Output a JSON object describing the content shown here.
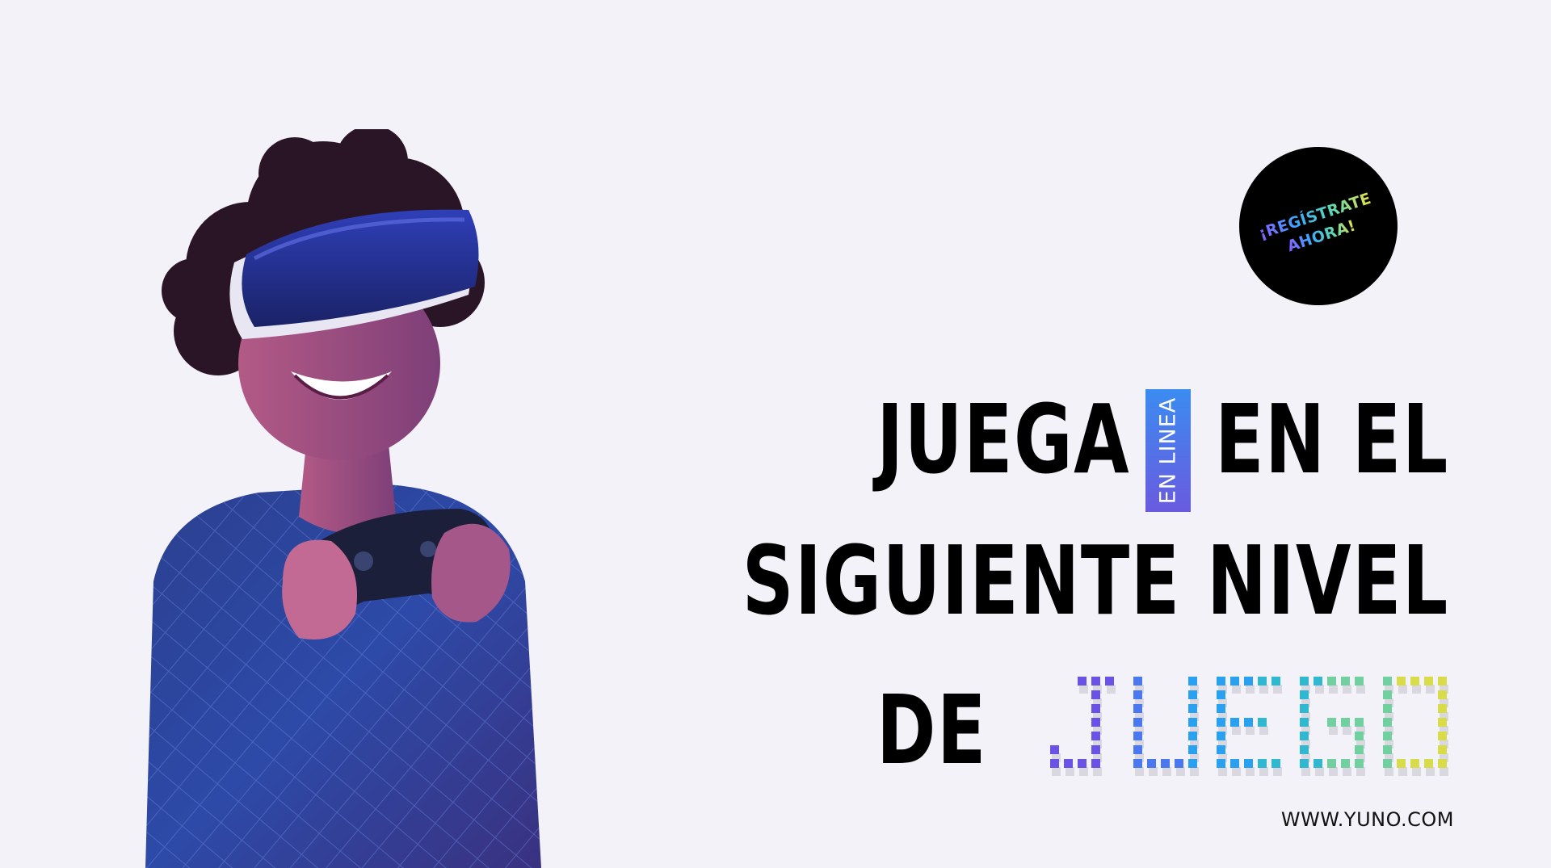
{
  "badge": {
    "line1": "¡REGÍSTRATE",
    "line2": "AHORA!"
  },
  "headline": {
    "line1_left": "JUEGA",
    "line1_right": "EN EL",
    "line2": "SIGUIENTE NIVEL",
    "line3": "DE"
  },
  "tag": {
    "label": "EN LINEA"
  },
  "pixel_word": {
    "text": "JUEGO",
    "colors": [
      "#6a52e6",
      "#4a78f0",
      "#2aa0f0",
      "#30b8d0",
      "#70d0a0",
      "#d8dc48"
    ]
  },
  "footer": {
    "url": "WWW.YUNO.COM"
  },
  "colors": {
    "background": "#f4f2f9",
    "text": "#000000",
    "accent_blue": "#3b8cf0",
    "accent_purple": "#6a5ae0"
  }
}
